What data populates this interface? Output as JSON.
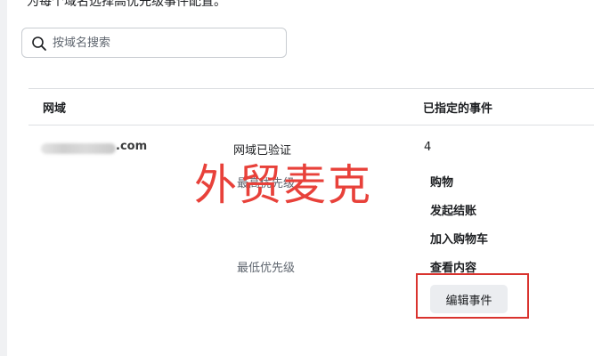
{
  "intro_text": "为每个域名选择高优先级事件配置。",
  "search": {
    "placeholder": "按域名搜索",
    "icon": "search-icon"
  },
  "table": {
    "headers": {
      "domain": "网域",
      "events": "已指定的事件"
    },
    "row": {
      "domain_suffix": ".com",
      "verification_status": "网域已验证",
      "priority_high": "最高优先级",
      "priority_low": "最低优先级",
      "event_count": "4",
      "events": [
        "购物",
        "发起结账",
        "加入购物车",
        "查看内容"
      ],
      "edit_button_label": "编辑事件"
    }
  },
  "watermark": "外贸麦克",
  "colors": {
    "watermark": "#e8413a",
    "highlight_border": "#d9332e",
    "button_bg": "#ebedf0"
  }
}
